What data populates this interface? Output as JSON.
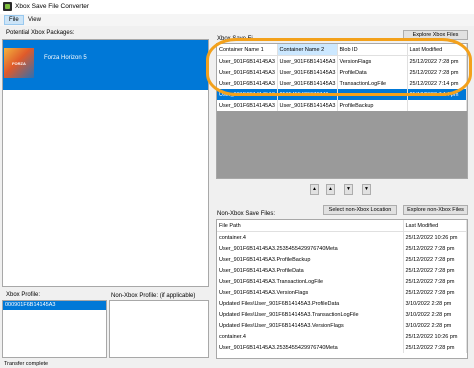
{
  "window": {
    "title": "Xbox Save File Converter",
    "icon": "xbox-converter-app-icon"
  },
  "menu": [
    {
      "label": "File",
      "active": true
    },
    {
      "label": "View",
      "active": false
    }
  ],
  "left": {
    "packages_label": "Potential Xbox Packages:",
    "packages": [
      {
        "name": "Forza Horizon 5",
        "tile_text": "FORZA",
        "selected": true
      }
    ],
    "xbox_profile_label": "Xbox Profile:",
    "xbox_profiles": [
      "000901F6B14145A3"
    ],
    "non_xbox_profile_label": "Non-Xbox Profile: (if applicable)"
  },
  "xbox_saves": {
    "label": "Xbox Save Fi",
    "explore_button": "Explore Xbox Files",
    "columns": [
      "Container Name 1",
      "Container Name 2",
      "Blob ID",
      "Last Modified"
    ],
    "highlighted_column": 1,
    "rows": [
      [
        "User_901F6B14145A3",
        "User_901F6B14145A3",
        "VersionFlags",
        "25/12/2022 7:28 pm"
      ],
      [
        "User_901F6B14145A3",
        "User_901F6B14145A3",
        "ProfileData",
        "25/12/2022 7:28 pm"
      ],
      [
        "User_901F6B14145A3",
        "User_901F6B14145A3",
        "TransactionLogFile",
        "25/12/2022 7:14 pm"
      ],
      [
        "User_901F6B14145A3",
        "2535455429976740",
        "",
        "25/12/2022 7:14 pm"
      ],
      [
        "User_901F6B14145A3",
        "User_901F6B14145A3",
        "ProfileBackup",
        ""
      ]
    ],
    "selected_row": 3
  },
  "arrows": [
    "▲",
    "▲",
    "▼",
    "▼"
  ],
  "non_xbox": {
    "label": "Non-Xbox Save Files:",
    "select_button": "Select non-Xbox Location",
    "explore_button": "Explore non-Xbox Files",
    "columns": [
      "File Path",
      "Last Modified"
    ],
    "rows": [
      [
        "container.4",
        "25/12/2022 10:26 pm"
      ],
      [
        "User_901F6B14145A3.2535455429976740Meta",
        "25/12/2022 7:28 pm"
      ],
      [
        "User_901F6B14145A3.ProfileBackup",
        "25/12/2022 7:28 pm"
      ],
      [
        "User_901F6B14145A3.ProfileData",
        "25/12/2022 7:28 pm"
      ],
      [
        "User_901F6B14145A3.TransactionLogFile",
        "25/12/2022 7:28 pm"
      ],
      [
        "User_901F6B14145A3.VersionFlags",
        "25/12/2022 7:28 pm"
      ],
      [
        "Updated Files\\User_901F6B14145A3.ProfileData",
        "3/10/2022 2:28 pm"
      ],
      [
        "Updated Files\\User_901F6B14145A3.TransactionLogFile",
        "3/10/2022 2:28 pm"
      ],
      [
        "Updated Files\\User_901F6B14145A3.VersionFlags",
        "3/10/2022 2:28 pm"
      ],
      [
        "container.4",
        "25/12/2022 10:26 pm"
      ],
      [
        "User_901F6B14145A3.2535455429976740Meta",
        "25/12/2022 7:28 pm"
      ]
    ]
  },
  "status": "Transfer complete",
  "colors": {
    "selection": "#0078d7",
    "annotation": "#f3a11b",
    "column_highlight": "#cce8ff"
  }
}
